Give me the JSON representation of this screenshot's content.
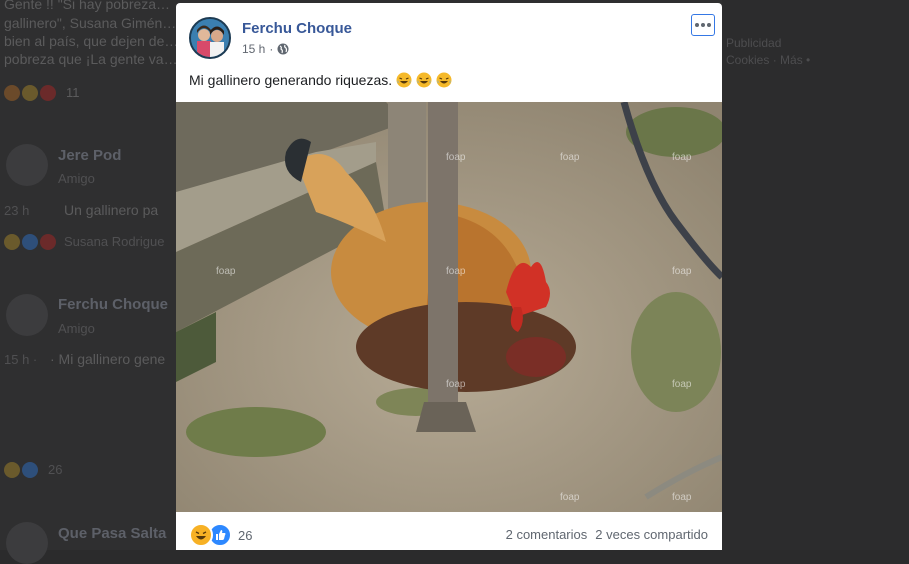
{
  "background": {
    "snippet_lines": [
      "Gente !! \"Si hay pobreza…",
      "gallinero\", Susana Gimén…",
      "bien al país, que dejen de…",
      "pobreza que ¡La gente va…"
    ],
    "snippet_react_count": "11",
    "comment1": {
      "name": "Jere Pod",
      "sub": "Amigo",
      "time": "23 h",
      "text": "Un gallinero pa",
      "reactors": "Susana Rodrigue"
    },
    "comment2": {
      "name": "Ferchu Choque",
      "sub": "Amigo",
      "time": "15 h ·",
      "text": "· Mi gallinero gene",
      "react_count": "26"
    },
    "comment3": {
      "name": "Que Pasa Salta"
    },
    "right_panel": {
      "line1": "Publicidad",
      "line2": "Cookies · Más •"
    }
  },
  "post": {
    "author": "Ferchu Choque",
    "time": "15 h",
    "separator": "·",
    "audience_icon": "globe-icon",
    "more_icon": "more-options-icon",
    "caption": "Mi gallinero generando riquezas.",
    "caption_emojis": [
      "laughing-tears-emoji",
      "laughing-tears-emoji",
      "laughing-tears-emoji"
    ],
    "image_watermark": "foap",
    "reactions": {
      "icons": [
        "haha-reaction-icon",
        "like-reaction-icon"
      ],
      "count": "26"
    },
    "comments_label": "2 comentarios",
    "shares_label": "2 veces compartido"
  },
  "colors": {
    "accent": "#385898",
    "like_blue": "#2d88ff",
    "haha_yellow": "#f7b125",
    "focus_ring": "#3578e5"
  }
}
